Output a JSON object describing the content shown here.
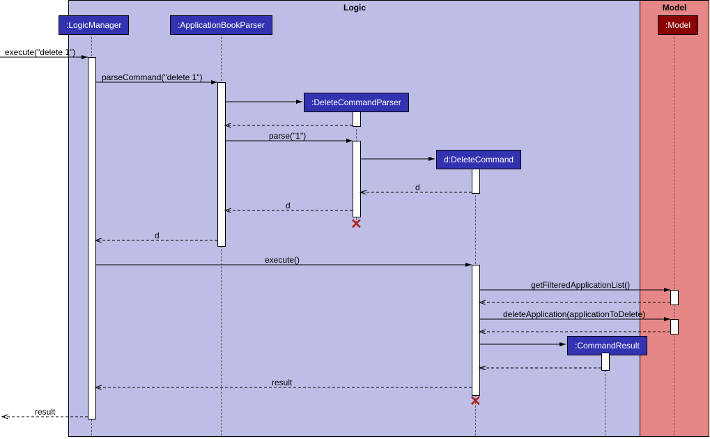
{
  "frames": {
    "logic": "Logic",
    "model": "Model"
  },
  "participants": {
    "logicManager": ":LogicManager",
    "appBookParser": ":ApplicationBookParser",
    "deleteCommandParser": ":DeleteCommandParser",
    "deleteCommand": "d:DeleteCommand",
    "commandResult": ":CommandResult",
    "model": ":Model"
  },
  "messages": {
    "execute1": "execute(\"delete 1\")",
    "parseCommand": "parseCommand(\"delete 1\")",
    "parse": "parse(\"1\")",
    "d1": "d",
    "d2": "d",
    "d3": "d",
    "execute2": "execute()",
    "getFiltered": "getFilteredApplicationList()",
    "deleteApp": "deleteApplication(applicationToDelete)",
    "result1": "result",
    "result2": "result"
  }
}
